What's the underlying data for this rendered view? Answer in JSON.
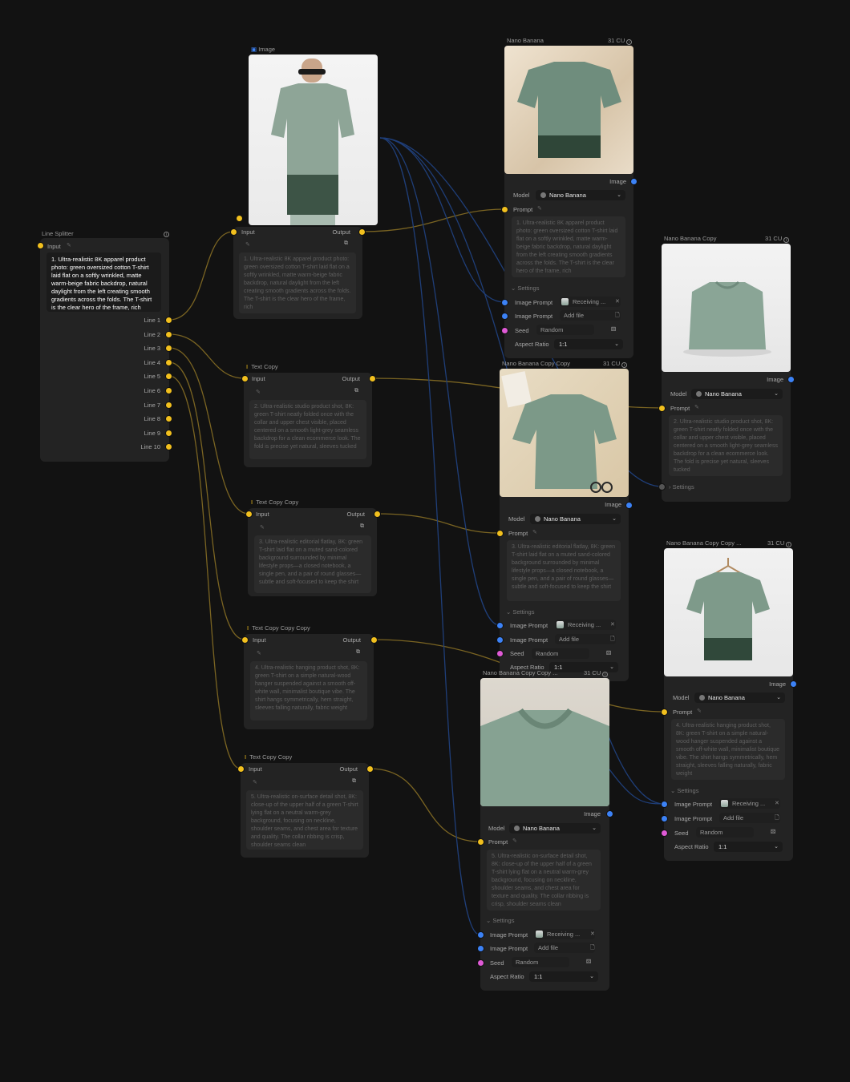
{
  "colors": {
    "canvas": "#121212",
    "node": "#232323",
    "yellow_port": "#f2c01e",
    "blue_port": "#3c82f6",
    "magenta_port": "#e05ad6",
    "wire_yellow": "#7a6422",
    "wire_blue": "#1f3e78"
  },
  "line_splitter": {
    "title": "Line Splitter",
    "input_label": "Input",
    "text": "1. Ultra-realistic 8K apparel product photo: green oversized cotton T-shirt laid flat on a softly wrinkled, matte warm-beige fabric backdrop, natural daylight from the left creating smooth gradients across the folds. The T-shirt is the clear hero of the frame, rich",
    "lines": [
      "Line 1",
      "Line 2",
      "Line 3",
      "Line 4",
      "Line 5",
      "Line 6",
      "Line 7",
      "Line 8",
      "Line 9",
      "Line 10"
    ]
  },
  "text_nodes": [
    {
      "title": "Image",
      "input": "Input",
      "output": "Output",
      "text": "1. Ultra-realistic 8K apparel product photo: green oversized cotton T-shirt laid flat on a softly wrinkled, matte warm-beige fabric backdrop, natural daylight from the left creating smooth gradients across the folds. The T-shirt is the clear hero of the frame, rich"
    },
    {
      "title": "Text Copy",
      "input": "Input",
      "output": "Output",
      "text": "2. Ultra-realistic studio product shot, 8K: green T-shirt neatly folded once with the collar and upper chest visible, placed centered on a smooth light-grey seamless backdrop for a clean ecommerce look. The fold is precise yet natural, sleeves tucked"
    },
    {
      "title": "Text Copy Copy",
      "input": "Input",
      "output": "Output",
      "text": "3. Ultra-realistic editorial flatlay, 8K: green T-shirt laid flat on a muted sand-colored background surrounded by minimal lifestyle props—a closed notebook, a single pen, and a pair of round glasses—subtle and soft-focused to keep the shirt"
    },
    {
      "title": "Text Copy Copy Copy",
      "input": "Input",
      "output": "Output",
      "text": "4. Ultra-realistic hanging product shot, 8K: green T-shirt on a simple natural-wood hanger suspended against a smooth off-white wall, minimalist boutique vibe. The shirt hangs symmetrically, hem straight, sleeves falling naturally, fabric weight"
    },
    {
      "title": "Text Copy Copy",
      "input": "Input",
      "output": "Output",
      "text": "5. Ultra-realistic on-surface detail shot, 8K: close-up of the upper half of a green T-shirt lying flat on a neutral warm-grey background, focusing on neckline, shoulder seams, and chest area for texture and quality. The collar ribbing is crisp, shoulder seams clean"
    }
  ],
  "gen_nodes": [
    {
      "title": "Nano Banana",
      "cost": "31 CU",
      "output_label": "Image",
      "model_label": "Model",
      "model_value": "Nano Banana",
      "prompt_label": "Prompt",
      "settings_label": "Settings",
      "image_prompt_label": "Image Prompt",
      "receiving": "Receiving ...",
      "add_file": "Add file",
      "seed_label": "Seed",
      "seed_value": "Random",
      "aspect_label": "Aspect Ratio",
      "aspect_value": "1:1",
      "prompt_text": "1. Ultra-realistic 8K apparel product photo: green oversized cotton T-shirt laid flat on a softly wrinkled, matte warm-beige fabric backdrop, natural daylight from the left creating smooth gradients across the folds. The T-shirt is the clear hero of the frame, rich"
    },
    {
      "title": "Nano Banana Copy",
      "cost": "31 CU",
      "output_label": "Image",
      "model_label": "Model",
      "model_value": "Nano Banana",
      "prompt_label": "Prompt",
      "settings_label": "Settings",
      "prompt_text": "2. Ultra-realistic studio product shot, 8K: green T-shirt neatly folded once with the collar and upper chest visible, placed centered on a smooth light-grey seamless backdrop for a clean ecommerce look. The fold is precise yet natural, sleeves tucked"
    },
    {
      "title": "Nano Banana Copy Copy",
      "cost": "31 CU",
      "output_label": "Image",
      "model_label": "Model",
      "model_value": "Nano Banana",
      "prompt_label": "Prompt",
      "settings_label": "Settings",
      "image_prompt_label": "Image Prompt",
      "receiving": "Receiving ...",
      "add_file": "Add file",
      "seed_label": "Seed",
      "seed_value": "Random",
      "aspect_label": "Aspect Ratio",
      "aspect_value": "1:1",
      "prompt_text": "3. Ultra-realistic editorial flatlay, 8K: green T-shirt laid flat on a muted sand-colored background surrounded by minimal lifestyle props—a closed notebook, a single pen, and a pair of round glasses—subtle and soft-focused to keep the shirt"
    },
    {
      "title": "Nano Banana Copy Copy ...",
      "cost": "31 CU",
      "output_label": "Image",
      "model_label": "Model",
      "model_value": "Nano Banana",
      "prompt_label": "Prompt",
      "settings_label": "Settings",
      "image_prompt_label": "Image Prompt",
      "receiving": "Receiving ...",
      "add_file": "Add file",
      "seed_label": "Seed",
      "seed_value": "Random",
      "aspect_label": "Aspect Ratio",
      "aspect_value": "1:1",
      "prompt_text": "4. Ultra-realistic hanging product shot, 8K: green T-shirt on a simple natural-wood hanger suspended against a smooth off-white wall, minimalist boutique vibe. The shirt hangs symmetrically, hem straight, sleeves falling naturally, fabric weight"
    },
    {
      "title": "Nano Banana Copy Copy ...",
      "cost": "31 CU",
      "output_label": "Image",
      "model_label": "Model",
      "model_value": "Nano Banana",
      "prompt_label": "Prompt",
      "settings_label": "Settings",
      "image_prompt_label": "Image Prompt",
      "receiving": "Receiving ...",
      "add_file": "Add file",
      "seed_label": "Seed",
      "seed_value": "Random",
      "aspect_label": "Aspect Ratio",
      "aspect_value": "1:1",
      "prompt_text": "5. Ultra-realistic on-surface detail shot, 8K: close-up of the upper half of a green T-shirt lying flat on a neutral warm-grey background, focusing on neckline, shoulder seams, and chest area for texture and quality. The collar ribbing is crisp, shoulder seams clean"
    }
  ]
}
